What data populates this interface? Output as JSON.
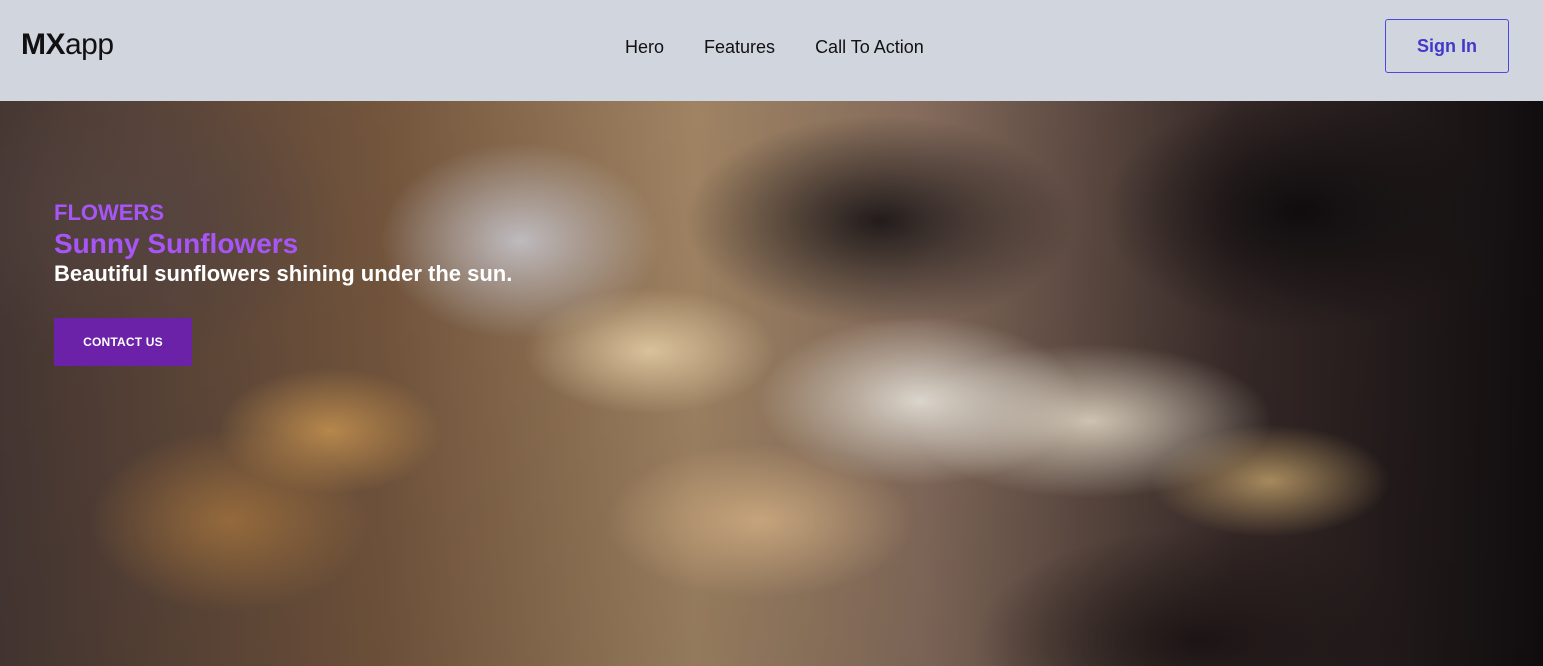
{
  "navbar": {
    "logo": {
      "bold": "MX",
      "light": "app"
    },
    "links": [
      "Hero",
      "Features",
      "Call To Action"
    ],
    "sign_in_label": "Sign In"
  },
  "hero": {
    "eyebrow": "FLOWERS",
    "title": "Sunny Sunflowers",
    "subtitle": "Beautiful sunflowers shining under the sun.",
    "cta_label": "CONTACT US"
  },
  "colors": {
    "navbar_bg": "#d1d5de",
    "accent_purple": "#a855f7",
    "cta_bg": "#6b21a8",
    "sign_in_border": "#4f46e5",
    "sign_in_text": "#4338ca"
  }
}
